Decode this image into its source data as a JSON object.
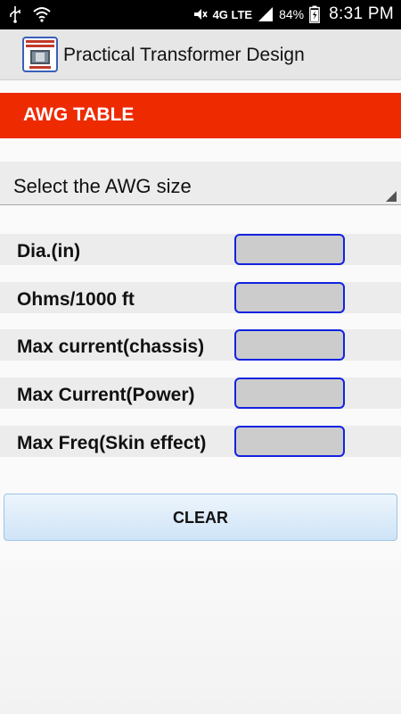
{
  "status_bar": {
    "time": "8:31 PM",
    "battery_percent": "84%",
    "network": "4G LTE",
    "icons": [
      "usb-icon",
      "wifi-icon",
      "mute-icon",
      "signal-icon",
      "battery-icon"
    ]
  },
  "action_bar": {
    "title": "Practical Transformer Design",
    "icon": "app-logo-icon"
  },
  "header": {
    "title": "AWG TABLE",
    "color": "#ee2a00"
  },
  "spinner": {
    "selected": "Select the AWG size"
  },
  "fields": [
    {
      "label": "Dia.(in)",
      "value": ""
    },
    {
      "label": "Ohms/1000 ft",
      "value": ""
    },
    {
      "label": "Max current(chassis)",
      "value": ""
    },
    {
      "label": "Max Current(Power)",
      "value": ""
    },
    {
      "label": "Max Freq(Skin effect)",
      "value": ""
    }
  ],
  "buttons": {
    "clear_label": "CLEAR"
  },
  "colors": {
    "field_border": "#1122e0",
    "field_fill": "#cccccc"
  }
}
